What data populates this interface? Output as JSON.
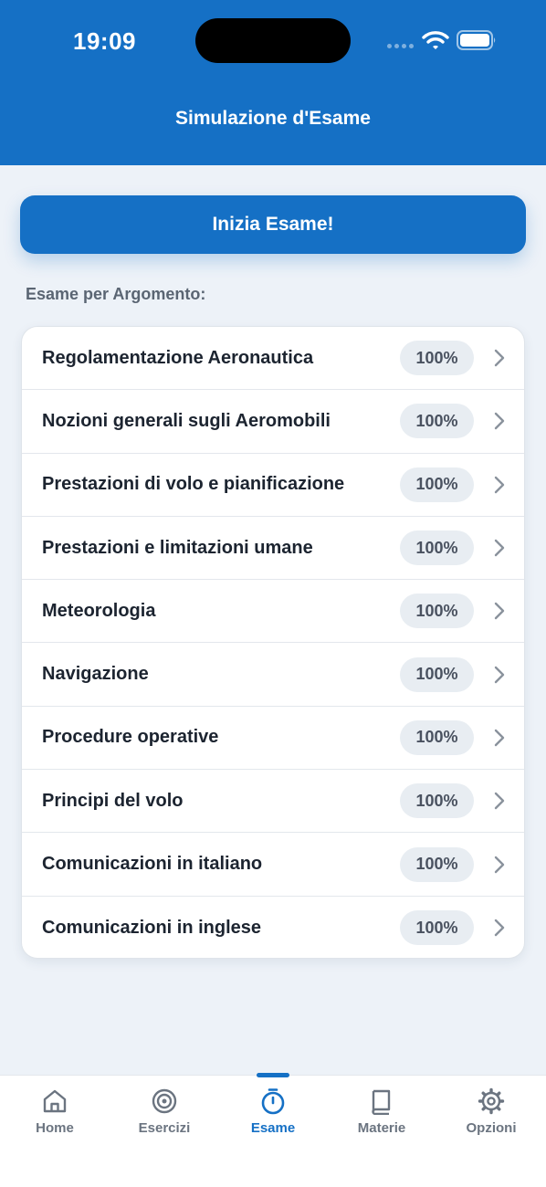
{
  "status_bar": {
    "time": "19:09"
  },
  "header": {
    "title": "Simulazione d'Esame"
  },
  "start_button": {
    "label": "Inizia Esame!"
  },
  "section": {
    "label": "Esame per Argomento:"
  },
  "topics": [
    {
      "label": "Regolamentazione Aeronautica",
      "badge": "100%"
    },
    {
      "label": "Nozioni generali sugli Aeromobili",
      "badge": "100%"
    },
    {
      "label": "Prestazioni di volo e pianificazione",
      "badge": "100%"
    },
    {
      "label": "Prestazioni e limitazioni umane",
      "badge": "100%"
    },
    {
      "label": "Meteorologia",
      "badge": "100%"
    },
    {
      "label": "Navigazione",
      "badge": "100%"
    },
    {
      "label": "Procedure operative",
      "badge": "100%"
    },
    {
      "label": "Principi del volo",
      "badge": "100%"
    },
    {
      "label": "Comunicazioni in italiano",
      "badge": "100%"
    },
    {
      "label": "Comunicazioni in inglese",
      "badge": "100%"
    }
  ],
  "tabbar": {
    "items": [
      {
        "label": "Home",
        "icon": "home-icon"
      },
      {
        "label": "Esercizi",
        "icon": "target-icon"
      },
      {
        "label": "Esame",
        "icon": "timer-icon",
        "active": true
      },
      {
        "label": "Materie",
        "icon": "book-icon"
      },
      {
        "label": "Opzioni",
        "icon": "gear-icon"
      }
    ]
  },
  "colors": {
    "primary": "#1570c5",
    "background": "#edf2f8",
    "text": "#1c2430",
    "muted": "#6b7480",
    "badge_bg": "#e8edf2"
  }
}
